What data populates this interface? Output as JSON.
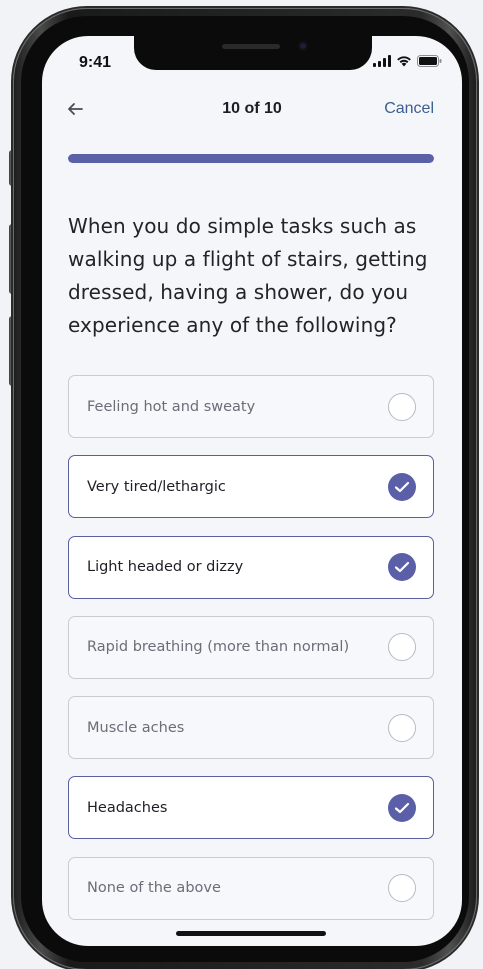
{
  "status_bar": {
    "time": "9:41",
    "icons": [
      "signal-icon",
      "wifi-icon",
      "battery-icon"
    ]
  },
  "nav": {
    "back_icon": "arrow-left-icon",
    "title": "10 of 10",
    "cancel_label": "Cancel"
  },
  "progress": {
    "current": 10,
    "total": 10,
    "fraction": 1.0
  },
  "question": {
    "text": "When you do simple tasks such as walking up a flight of stairs, getting dressed, having a shower, do you experience any of the following?"
  },
  "options": [
    {
      "label": "Feeling hot and sweaty",
      "selected": false
    },
    {
      "label": "Very tired/lethargic",
      "selected": true
    },
    {
      "label": "Light headed or dizzy",
      "selected": true
    },
    {
      "label": "Rapid breathing (more than normal)",
      "selected": false
    },
    {
      "label": "Muscle aches",
      "selected": false
    },
    {
      "label": "Headaches",
      "selected": true
    },
    {
      "label": "None of the above",
      "selected": false
    }
  ],
  "colors": {
    "accent": "#5a5fa8",
    "link": "#3b5f8f",
    "background": "#f5f6fa"
  }
}
